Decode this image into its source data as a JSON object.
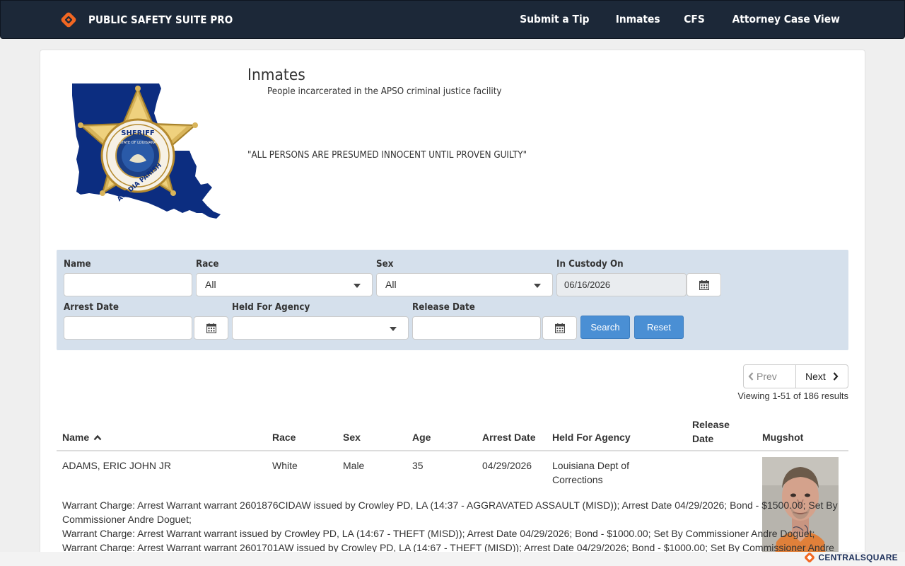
{
  "navbar": {
    "brand": "PUBLIC SAFETY SUITE PRO",
    "links": [
      "Submit a Tip",
      "Inmates",
      "CFS",
      "Attorney Case View"
    ]
  },
  "header": {
    "title": "Inmates",
    "subtitle": "People incarcerated in the APSO criminal justice facility",
    "motto": "\"ALL PERSONS ARE PRESUMED INNOCENT UNTIL PROVEN GUILTY\""
  },
  "seal": {
    "top_text": "SHERIFF",
    "bottom_text": "ACADIA PARISH",
    "inner_text": "STATE OF LOUISIANA"
  },
  "filters": {
    "name_label": "Name",
    "name_value": "",
    "race_label": "Race",
    "race_value": "All",
    "sex_label": "Sex",
    "sex_value": "All",
    "custody_label": "In Custody On",
    "custody_value": "06/16/2026",
    "arrest_label": "Arrest Date",
    "arrest_value": "",
    "agency_label": "Held For Agency",
    "agency_value": "",
    "release_label": "Release Date",
    "release_value": "",
    "search_label": "Search",
    "reset_label": "Reset"
  },
  "pager": {
    "prev": "Prev",
    "next": "Next",
    "viewing": "Viewing 1-51 of 186 results"
  },
  "table": {
    "columns": [
      "Name",
      "Race",
      "Sex",
      "Age",
      "Arrest Date",
      "Held For Agency",
      "Release Date",
      "Mugshot"
    ],
    "release_col_line1": "Release",
    "release_col_line2": "Date",
    "rows": [
      {
        "name": "ADAMS, ERIC JOHN JR",
        "race": "White",
        "sex": "Male",
        "age": "35",
        "arrest_date": "04/29/2026",
        "agency_line1": "Louisiana Dept of",
        "agency_line2": "Corrections",
        "release_date": "",
        "charges": [
          "Warrant Charge: Arrest Warrant warrant 2601876CIDAW issued by Crowley PD, LA (14:37 - AGGRAVATED ASSAULT (MISD)); Arrest Date 04/29/2026; Bond - $1500.00; Set By Commissioner Andre Doguet;",
          "Warrant Charge: Arrest Warrant warrant issued by Crowley PD, LA (14:67 - THEFT (MISD)); Arrest Date 04/29/2026; Bond - $1000.00; Set By Commissioner Andre Doguet;",
          "Warrant Charge: Arrest Warrant warrant 2601701AW issued by Crowley PD, LA (14:67 - THEFT (MISD)); Arrest Date 04/29/2026; Bond - $1000.00; Set By Commissioner Andre"
        ]
      }
    ]
  },
  "footer": {
    "vendor": "CENTRALSQUARE"
  },
  "colors": {
    "navbar": "#1c2838",
    "filter_panel": "#d5e0ec",
    "button_blue": "#4a8fd4",
    "logo_orange": "#f26722"
  }
}
